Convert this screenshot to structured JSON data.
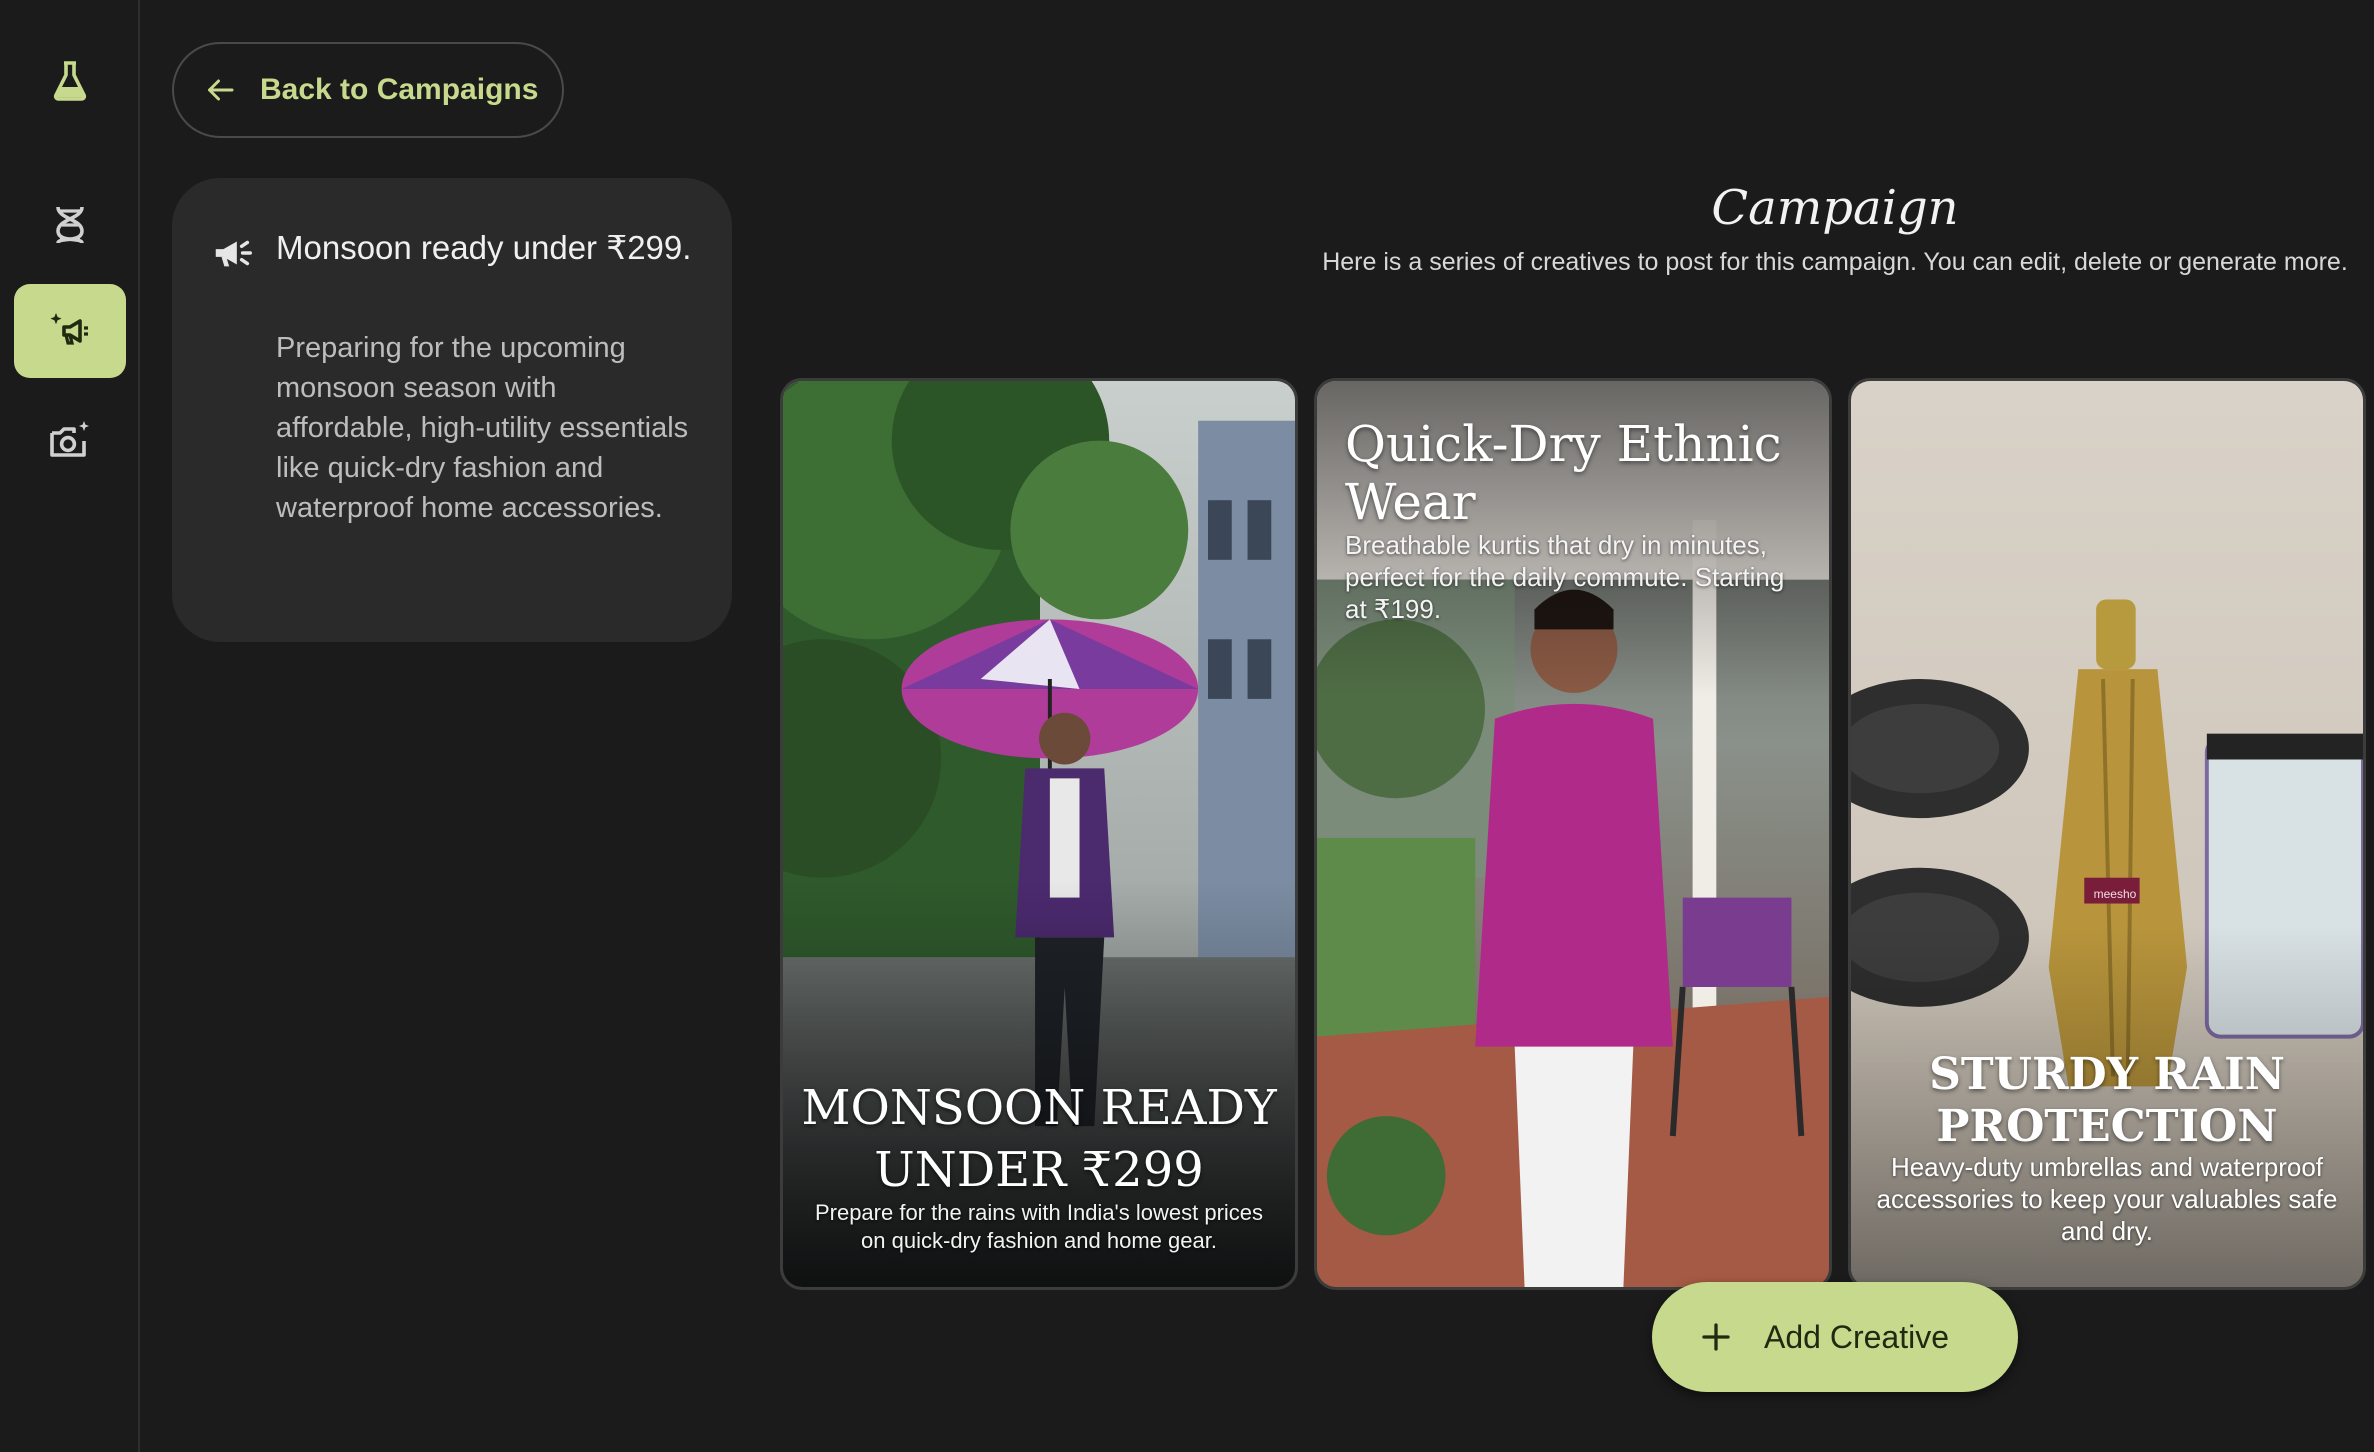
{
  "nav": {
    "items": [
      {
        "icon": "flask-icon",
        "active": false
      },
      {
        "icon": "dna-icon",
        "active": false
      },
      {
        "icon": "campaign-megaphone-icon",
        "active": true
      },
      {
        "icon": "add-photo-icon",
        "active": false
      }
    ],
    "accent_color": "#c6d98d"
  },
  "back_button": {
    "label": "Back to Campaigns",
    "icon": "arrow-left-icon"
  },
  "campaign_info": {
    "icon": "megaphone-icon",
    "title": "Monsoon ready under ₹299.",
    "description": "Preparing for the upcoming monsoon season with affordable, high-utility essentials like quick-dry fashion and waterproof home accessories."
  },
  "header": {
    "title": "Campaign",
    "subtitle": "Here is a series of creatives to post for this campaign. You can edit, delete or generate more."
  },
  "creatives": [
    {
      "headline": "MONSOON READY UNDER ₹299",
      "body": "Prepare for the rains with India's lowest prices on quick-dry fashion and home gear."
    },
    {
      "headline": "Quick-Dry Ethnic Wear",
      "body": "Breathable kurtis that dry in minutes, perfect for the daily commute. Starting at ₹199."
    },
    {
      "headline": "STURDY RAIN PROTECTION",
      "body": "Heavy-duty umbrellas and waterproof accessories to keep your valuables safe and dry.",
      "brand_tag": "meesho"
    }
  ],
  "add_button": {
    "label": "Add Creative",
    "icon": "plus-icon"
  }
}
